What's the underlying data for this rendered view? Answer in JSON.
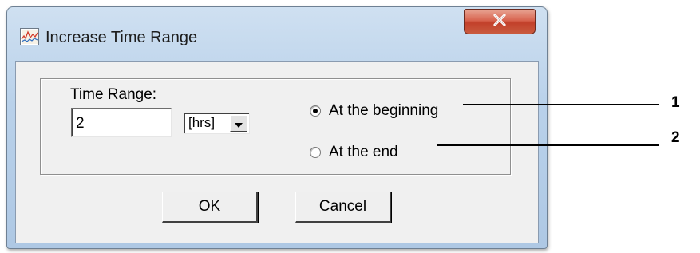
{
  "window": {
    "title": "Increase Time Range",
    "icon": "chart-app-icon",
    "close_icon": "close-x-icon"
  },
  "form": {
    "time_range_label": "Time Range:",
    "time_range_value": "2",
    "unit_selected": "[hrs]"
  },
  "options": {
    "at_beginning_label": "At the beginning",
    "at_beginning_checked": true,
    "at_end_label": "At the end",
    "at_end_checked": false
  },
  "buttons": {
    "ok_label": "OK",
    "cancel_label": "Cancel"
  },
  "callouts": {
    "first": "1",
    "second": "2"
  }
}
